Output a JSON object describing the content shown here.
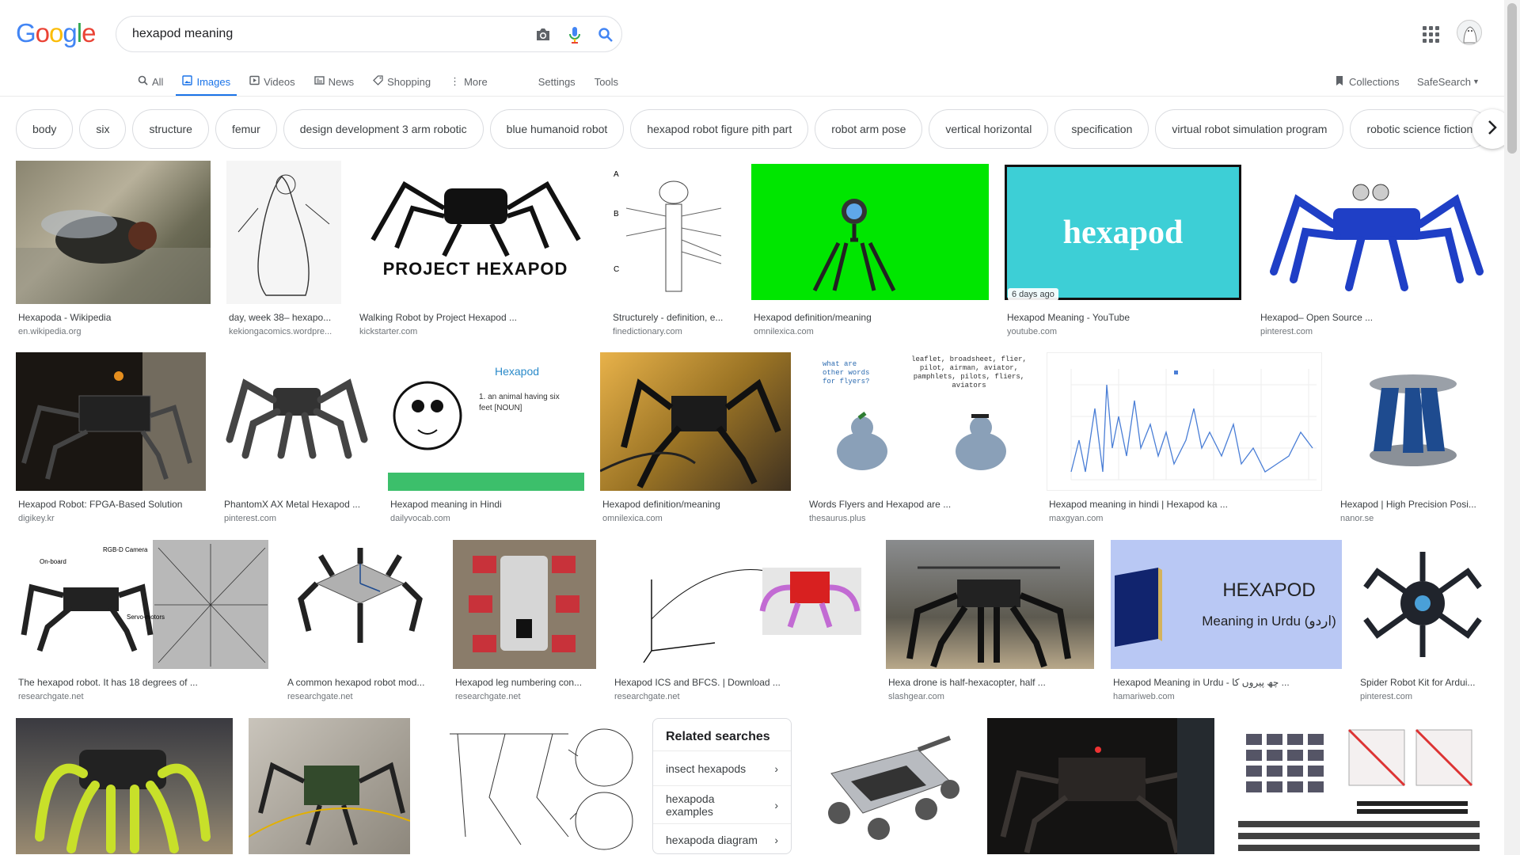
{
  "logo": {
    "letters": [
      "G",
      "o",
      "o",
      "g",
      "l",
      "e"
    ]
  },
  "search": {
    "query": "hexapod meaning"
  },
  "tabs": [
    {
      "label": "All",
      "icon": "search-icon"
    },
    {
      "label": "Images",
      "icon": "image-icon"
    },
    {
      "label": "Videos",
      "icon": "video-icon"
    },
    {
      "label": "News",
      "icon": "news-icon"
    },
    {
      "label": "Shopping",
      "icon": "tag-icon"
    },
    {
      "label": "More",
      "icon": "more-vert-icon"
    },
    {
      "label": "Settings"
    },
    {
      "label": "Tools"
    }
  ],
  "right_tools": {
    "collections": "Collections",
    "safesearch": "SafeSearch"
  },
  "chips": [
    "body",
    "six",
    "structure",
    "femur",
    "design development 3 arm robotic",
    "blue humanoid robot",
    "hexapod robot figure pith part",
    "robot arm pose",
    "vertical horizontal",
    "specification",
    "virtual robot simulation program",
    "robotic science fiction"
  ],
  "results_row1": [
    {
      "caption": "Hexapoda - Wikipedia",
      "source": "en.wikipedia.org"
    },
    {
      "caption": "day, week 38– hexapo...",
      "source": "kekiongacomics.wordpre..."
    },
    {
      "caption": "Walking Robot by Project Hexapod ...",
      "source": "kickstarter.com",
      "image_text": "PROJECT HEXAPOD"
    },
    {
      "caption": "Structurely - definition, e...",
      "source": "finedictionary.com"
    },
    {
      "caption": "Hexapod definition/meaning",
      "source": "omnilexica.com"
    },
    {
      "caption": "Hexapod Meaning - YouTube",
      "source": "youtube.com",
      "image_text": "hexapod",
      "badge": "6 days ago"
    },
    {
      "caption": "Hexapod– Open Source ...",
      "source": "pinterest.com"
    }
  ],
  "results_row2": [
    {
      "caption": "Hexapod Robot: FPGA-Based Solution",
      "source": "digikey.kr"
    },
    {
      "caption": "PhantomX AX Metal Hexapod ...",
      "source": "pinterest.com"
    },
    {
      "caption": "Hexapod meaning in Hindi",
      "source": "dailyvocab.com",
      "image_title": "Hexapod",
      "image_def": "1. an animal having six feet [NOUN]"
    },
    {
      "caption": "Hexapod definition/meaning",
      "source": "omnilexica.com"
    },
    {
      "caption": "Words Flyers and Hexapod are ...",
      "source": "thesaurus.plus",
      "image_q": "what are other words for flyers?",
      "image_list": "leaflet, broadsheet, flier, pilot, airman, aviator, pamphlets, pilots, fliers, aviators"
    },
    {
      "caption": "Hexapod meaning in hindi | Hexapod ka ...",
      "source": "maxgyan.com"
    },
    {
      "caption": "Hexapod | High Precision Posi...",
      "source": "nanor.se"
    }
  ],
  "results_row3": [
    {
      "caption": "The hexapod robot. It has 18 degrees of ...",
      "source": "researchgate.net"
    },
    {
      "caption": "A common hexapod robot mod...",
      "source": "researchgate.net"
    },
    {
      "caption": "Hexapod leg numbering con...",
      "source": "researchgate.net"
    },
    {
      "caption": "Hexapod ICS and BFCS. | Download ...",
      "source": "researchgate.net"
    },
    {
      "caption": "Hexa drone is half-hexacopter, half ...",
      "source": "slashgear.com"
    },
    {
      "caption": "Hexapod Meaning in Urdu - چھ پیروں کا ...",
      "source": "hamariweb.com",
      "image_title": "HEXAPOD",
      "image_sub": "Meaning in Urdu (اردو)"
    },
    {
      "caption": "Spider Robot Kit for Ardui...",
      "source": "pinterest.com"
    }
  ],
  "related": {
    "title": "Related searches",
    "items": [
      "insect hexapods",
      "hexapoda examples",
      "hexapoda diagram"
    ]
  },
  "colors": {
    "accent": "#1a73e8",
    "green_screen": "#00e600",
    "youtube_bg": "#3dcfd6",
    "urdu_bg": "#b9c8f4"
  }
}
